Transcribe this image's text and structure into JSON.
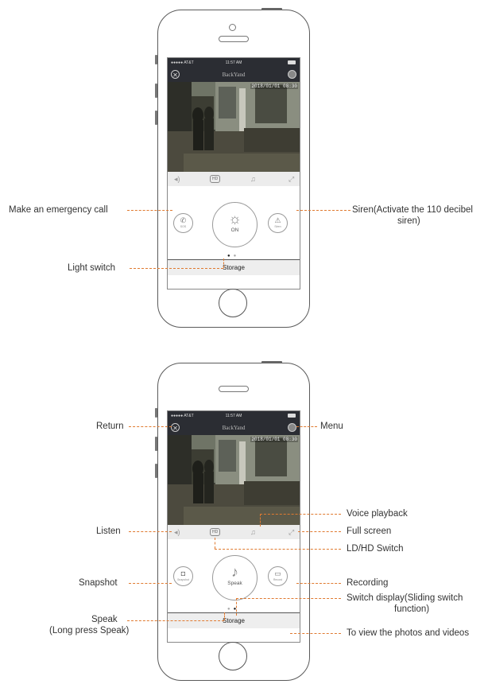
{
  "phone": {
    "carrier": "●●●●● AT&T",
    "time": "11:57 AM",
    "app_title": "BackYand",
    "timestamp": "2018/01/01 08:30",
    "hd_label": "HD",
    "storage_label": "Storage"
  },
  "top_screen": {
    "left_button_label": "SOS",
    "center_button_label": "ON",
    "right_button_label": "Siren"
  },
  "bottom_screen": {
    "left_button_label": "Snapshot",
    "center_button_label": "Speak",
    "right_button_label": "Record"
  },
  "callouts_top": {
    "emergency_call": "Make an emergency call",
    "light_switch": "Light switch",
    "siren_line1": "Siren(Activate the 110 decibel",
    "siren_line2": "siren)"
  },
  "callouts_bottom": {
    "return": "Return",
    "menu": "Menu",
    "voice_playback": "Voice playback",
    "listen": "Listen",
    "full_screen": "Full screen",
    "ld_hd_switch": "LD/HD Switch",
    "snapshot": "Snapshot",
    "recording": "Recording",
    "switch_display_line1": "Switch display(Sliding switch",
    "switch_display_line2": "function)",
    "speak_line1": "Speak",
    "speak_line2": "(Long press Speak)",
    "view_photos": "To view the photos and videos"
  },
  "colors": {
    "callout_line": "#e07a30",
    "nav_bar": "#2b2d33"
  },
  "icons": [
    "close-icon",
    "menu-icon",
    "listen-icon",
    "hd-icon",
    "voice-playback-icon",
    "fullscreen-icon",
    "phone-icon",
    "bulb-icon",
    "siren-icon",
    "camera-icon",
    "mic-icon",
    "record-icon"
  ]
}
